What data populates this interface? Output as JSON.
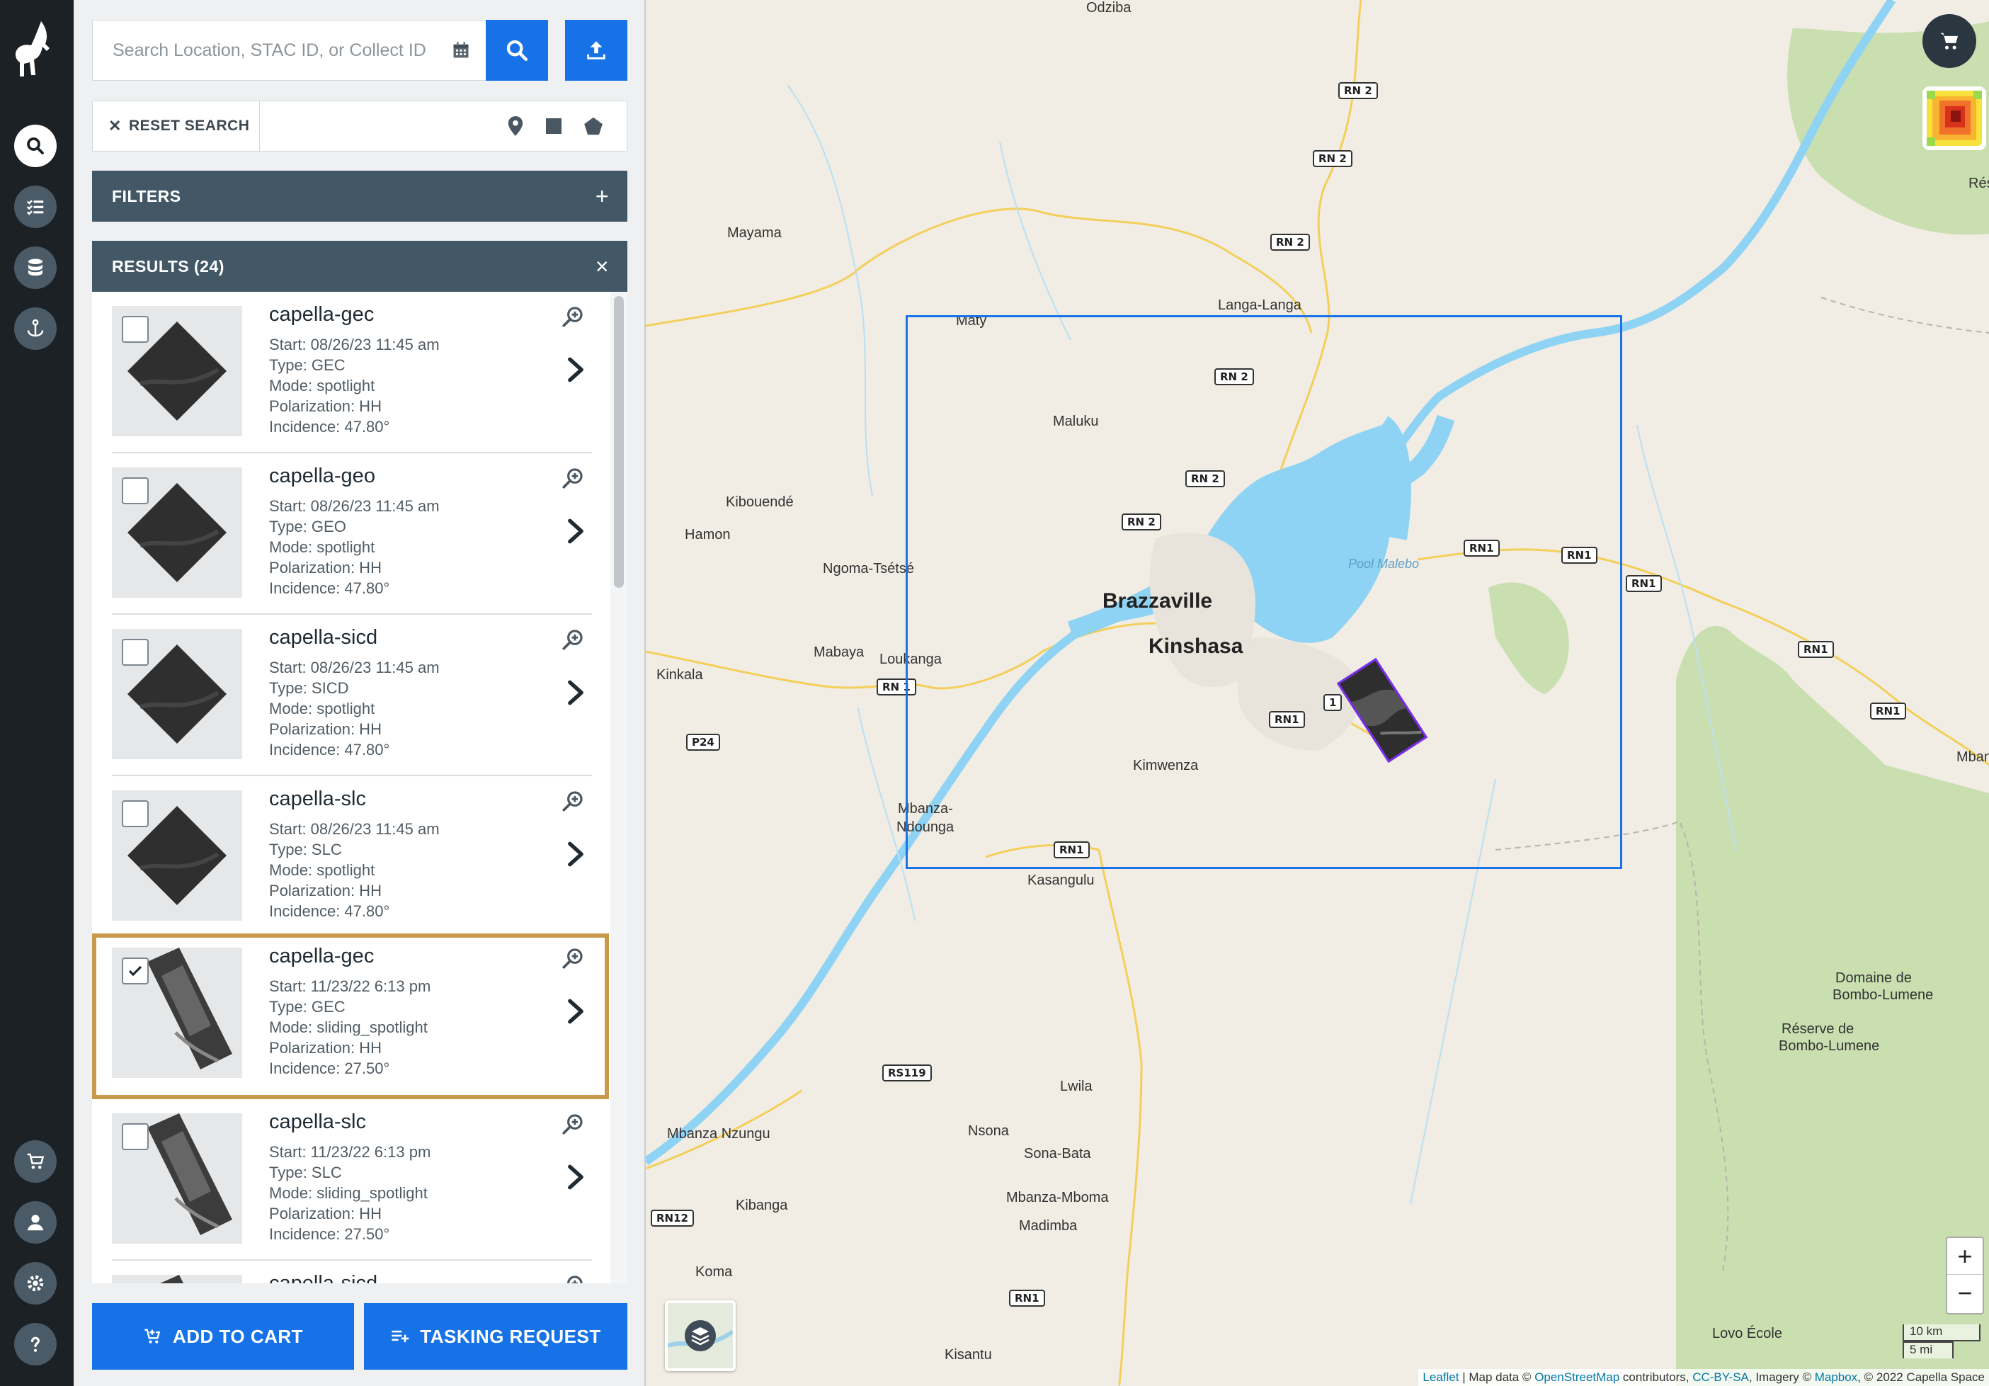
{
  "rail": {
    "items": [
      {
        "name": "search",
        "icon": "search-icon"
      },
      {
        "name": "tasks",
        "icon": "checklist-icon"
      },
      {
        "name": "catalog",
        "icon": "database-icon"
      },
      {
        "name": "sensor",
        "icon": "anchor-icon"
      }
    ],
    "bottom_items": [
      {
        "name": "cart",
        "icon": "cart-icon"
      },
      {
        "name": "account",
        "icon": "user-icon"
      },
      {
        "name": "settings",
        "icon": "gear-icon"
      },
      {
        "name": "help",
        "icon": "help-icon"
      }
    ]
  },
  "search": {
    "placeholder": "Search Location, STAC ID, or Collect ID",
    "value": ""
  },
  "tools": {
    "reset_label": "RESET SEARCH"
  },
  "filters": {
    "label": "FILTERS",
    "action": "+"
  },
  "results": {
    "label": "RESULTS (24)",
    "close": "×",
    "items": [
      {
        "title": "capella-gec",
        "start": "Start: 08/26/23 11:45 am",
        "type": "Type: GEC",
        "mode": "Mode: spotlight",
        "polarization": "Polarization: HH",
        "incidence": "Incidence: 47.80°",
        "checked": false
      },
      {
        "title": "capella-geo",
        "start": "Start: 08/26/23 11:45 am",
        "type": "Type: GEO",
        "mode": "Mode: spotlight",
        "polarization": "Polarization: HH",
        "incidence": "Incidence: 47.80°",
        "checked": false
      },
      {
        "title": "capella-sicd",
        "start": "Start: 08/26/23 11:45 am",
        "type": "Type: SICD",
        "mode": "Mode: spotlight",
        "polarization": "Polarization: HH",
        "incidence": "Incidence: 47.80°",
        "checked": false
      },
      {
        "title": "capella-slc",
        "start": "Start: 08/26/23 11:45 am",
        "type": "Type: SLC",
        "mode": "Mode: spotlight",
        "polarization": "Polarization: HH",
        "incidence": "Incidence: 47.80°",
        "checked": false
      },
      {
        "title": "capella-gec",
        "start": "Start: 11/23/22 6:13 pm",
        "type": "Type: GEC",
        "mode": "Mode: sliding_spotlight",
        "polarization": "Polarization: HH",
        "incidence": "Incidence: 27.50°",
        "checked": true
      },
      {
        "title": "capella-slc",
        "start": "Start: 11/23/22 6:13 pm",
        "type": "Type: SLC",
        "mode": "Mode: sliding_spotlight",
        "polarization": "Polarization: HH",
        "incidence": "Incidence: 27.50°",
        "checked": false
      },
      {
        "title": "capella-sicd",
        "start": "",
        "type": "",
        "mode": "",
        "polarization": "",
        "incidence": "",
        "checked": false
      }
    ]
  },
  "actions": {
    "add_to_cart": "ADD TO CART",
    "tasking_request": "TASKING REQUEST"
  },
  "map": {
    "places": [
      {
        "name": "Odziba",
        "big": false
      },
      {
        "name": "Mayama",
        "big": false
      },
      {
        "name": "Langa-Langa",
        "big": false
      },
      {
        "name": "Maty",
        "big": false
      },
      {
        "name": "Maluku",
        "big": false
      },
      {
        "name": "Kibouendé",
        "big": false
      },
      {
        "name": "Hamon",
        "big": false
      },
      {
        "name": "Ngoma-Tsétsé",
        "big": false
      },
      {
        "name": "Brazzaville",
        "big": true
      },
      {
        "name": "Kinshasa",
        "big": true
      },
      {
        "name": "Mabaya",
        "big": false
      },
      {
        "name": "Loukanga",
        "big": false
      },
      {
        "name": "Kinkala",
        "big": false
      },
      {
        "name": "Kimwenza",
        "big": false
      },
      {
        "name": "Mbanza-",
        "big": false
      },
      {
        "name": "Ndounga",
        "big": false
      },
      {
        "name": "Kasangulu",
        "big": false
      },
      {
        "name": "Lwila",
        "big": false
      },
      {
        "name": "Nsona",
        "big": false
      },
      {
        "name": "Sona-Bata",
        "big": false
      },
      {
        "name": "Mbanza Nzungu",
        "big": false
      },
      {
        "name": "Kibanga",
        "big": false
      },
      {
        "name": "Mbanza-Mboma",
        "big": false
      },
      {
        "name": "Madimba",
        "big": false
      },
      {
        "name": "Koma",
        "big": false
      },
      {
        "name": "Kisantu",
        "big": false
      },
      {
        "name": "Lovo École",
        "big": false
      },
      {
        "name": "Mbankan",
        "big": false
      },
      {
        "name": "Domaine de",
        "big": false
      },
      {
        "name": "Bombo-Lumene",
        "big": false
      },
      {
        "name": "Réserve de",
        "big": false
      },
      {
        "name": "Bombo-Lumene",
        "big": false
      },
      {
        "name": "Rés",
        "big": false
      },
      {
        "name": "Pool Malebo",
        "big": false
      }
    ],
    "shields": [
      "RN 2",
      "RN 2",
      "RN 2",
      "RN 2",
      "RN 2",
      "RN 2",
      "RN1",
      "RN1",
      "RN1",
      "RN1",
      "RN1",
      "RN 1",
      "P24",
      "RN1",
      "RN1",
      "RS119",
      "RN12",
      "RN1",
      "1"
    ],
    "zoom_in": "+",
    "zoom_out": "−",
    "scale_km": "10 km",
    "scale_mi": "5 mi",
    "attribution": {
      "leaflet": "Leaflet",
      "sep1": " | Map data © ",
      "osm": "OpenStreetMap",
      "sep2": " contributors, ",
      "ccbysa": "CC-BY-SA",
      "sep3": ", Imagery © ",
      "mapbox": "Mapbox",
      "sep4": ", © 2022 Capella Space"
    }
  },
  "colors": {
    "accent": "#1672e6",
    "rail": "#1c2126",
    "header": "#435866",
    "selected": "#c99a4b",
    "aoi": "#1a73e8",
    "footprint": "#7a2cf0",
    "water": "#8fd3f4"
  }
}
